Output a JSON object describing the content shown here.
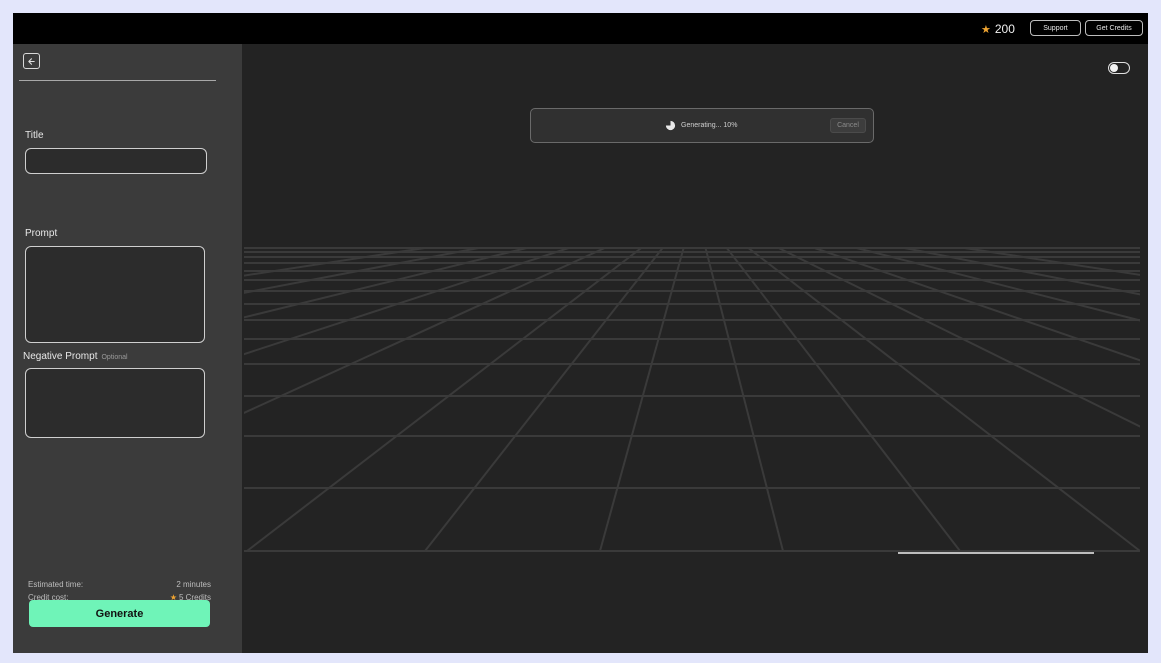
{
  "header": {
    "credit_balance": "200",
    "support_label": "Support",
    "get_credits_label": "Get Credits"
  },
  "sidebar": {
    "title_label": "Title",
    "title_value": "",
    "prompt_label": "Prompt",
    "prompt_value": "",
    "negative_prompt_label": "Negative Prompt",
    "negative_prompt_optional": "Optional",
    "negative_prompt_value": "",
    "estimated_time_label": "Estimated time:",
    "estimated_time_value": "2 minutes",
    "credit_cost_label": "Credit cost:",
    "credit_cost_value": "5 Credits",
    "generate_label": "Generate"
  },
  "viewport": {
    "toggle_on": false,
    "progress_text": "Generating... 10%",
    "progress_percent": 10,
    "cancel_label": "Cancel"
  },
  "colors": {
    "accent": "#6ff4b8",
    "star": "#f0a531",
    "background": "#232323",
    "sidebar": "#3b3b3b"
  },
  "icons": [
    "star-icon",
    "back-arrow-icon",
    "toggle-switch",
    "progress-spinner-icon"
  ]
}
